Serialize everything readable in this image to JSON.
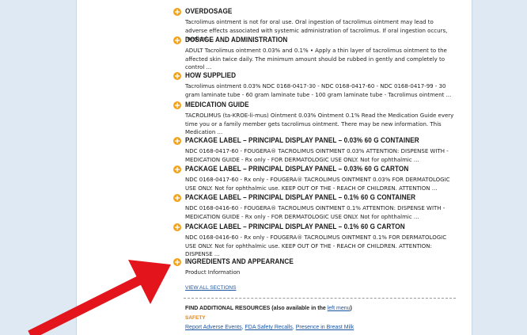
{
  "sections": [
    {
      "title": "OVERDOSAGE",
      "body": "Tacrolimus ointment is not for oral use. Oral ingestion of tacrolimus ointment may lead to adverse effects associated with systemic administration of tacrolimus. If oral ingestion occurs, medical ..."
    },
    {
      "title": "DOSAGE AND ADMINISTRATION",
      "body": "ADULT Tacrolimus ointment 0.03% and 0.1% • Apply a thin layer of tacrolimus ointment to the affected skin twice daily. The minimum amount should be rubbed in gently and completely to control ..."
    },
    {
      "title": "HOW SUPPLIED",
      "body": "Tacrolimus ointment 0.03% NDC 0168-0417-30 - NDC 0168-0417-60 - NDC 0168-0417-99 - 30 gram laminate tube - 60 gram laminate tube - 100 gram laminate tube - Tacrolimus ointment ..."
    },
    {
      "title": "MEDICATION GUIDE",
      "body": "TACROLIMUS (ta-KROE-li-mus) Ointment 0.03% Ointment 0.1% Read the Medication Guide every time you or a family member gets tacrolimus ointment. There may be new information. This Medication ..."
    },
    {
      "title": "PACKAGE LABEL – PRINCIPAL DISPLAY PANEL – 0.03% 60 G CONTAINER",
      "body": "NDC 0168-0417-60 - FOUGERA®   TACROLIMUS OINTMENT 0.03%   ATTENTION: DISPENSE WITH - MEDICATION GUIDE - Rx only -   FOR DERMATOLOGIC USE ONLY. Not for ophthalmic ..."
    },
    {
      "title": "PACKAGE LABEL – PRINCIPAL DISPLAY PANEL – 0.03% 60 G CARTON",
      "body": "NDC 0168-0417-60 - Rx only - FOUGERA®   TACROLIMUS OINTMENT 0.03%   FOR DERMATOLOGIC USE ONLY. Not for ophthalmic use. KEEP OUT OF THE - REACH OF CHILDREN.   ATTENTION ..."
    },
    {
      "title": "PACKAGE LABEL – PRINCIPAL DISPLAY PANEL – 0.1% 60 G CONTAINER",
      "body": "NDC 0168-0416-60 - FOUGERA®   TACROLIMUS OINTMENT 0.1%   ATTENTION: DISPENSE WITH - MEDICATION GUIDE - Rx only -   FOR DERMATOLOGIC USE ONLY. Not for ophthalmic ..."
    },
    {
      "title": "PACKAGE LABEL – PRINCIPAL DISPLAY PANEL – 0.1% 60 G CARTON",
      "body": "NDC 0168-0416-60 - Rx only - FOUGERA®   TACROLIMUS OINTMENT 0.1%   FOR DERMATOLOGIC USE ONLY. Not for ophthalmic use. KEEP OUT OF THE - REACH OF CHILDREN.   ATTENTION: DISPENSE ..."
    },
    {
      "title": "INGREDIENTS AND APPEARANCE",
      "body": "Product Information"
    }
  ],
  "view_all": "VIEW ALL SECTIONS",
  "resources": {
    "title": "FIND ADDITIONAL RESOURCES (also available in the ",
    "title_link": "left menu",
    "title_end": ")",
    "safety_label": "SAFETY",
    "links": [
      "Report Adverse Events",
      "FDA Safety Recalls",
      "Presence in Breast Milk"
    ],
    "separator": ", "
  },
  "colors": {
    "accent_icon": "#f5a21b",
    "link": "#1b56a4",
    "safety": "#e8830c",
    "arrow": "#e3141b"
  },
  "icons": {
    "section_expand": "plus-circle-icon",
    "annotation": "red-arrow"
  }
}
